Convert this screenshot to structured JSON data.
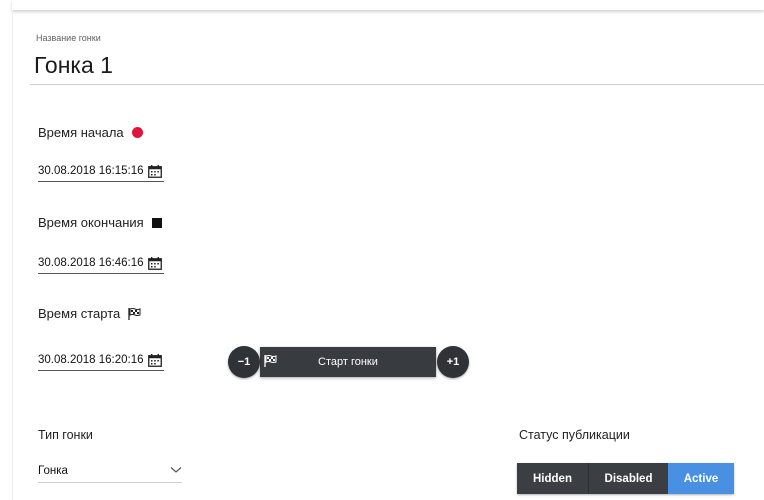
{
  "race_name": {
    "label": "Название гонки",
    "value": "Гонка 1"
  },
  "start_time": {
    "title": "Время начала",
    "value": "30.08.2018 16:15:16",
    "indicator_color": "#e0143c"
  },
  "end_time": {
    "title": "Время окончания",
    "value": "30.08.2018 16:46:16",
    "indicator_color": "#111111"
  },
  "race_start": {
    "title": "Время старта",
    "value": "30.08.2018 16:20:16",
    "minus_label": "−1",
    "plus_label": "+1",
    "start_button_label": "Старт гонки"
  },
  "race_type": {
    "label": "Тип гонки",
    "selected": "Гонка"
  },
  "publication_status": {
    "label": "Статус публикации",
    "options": [
      "Hidden",
      "Disabled",
      "Active"
    ],
    "active": "Active",
    "accent_color": "#4a90e2"
  },
  "icons": [
    "calendar-icon",
    "flag-icon",
    "chevron-down-icon"
  ]
}
